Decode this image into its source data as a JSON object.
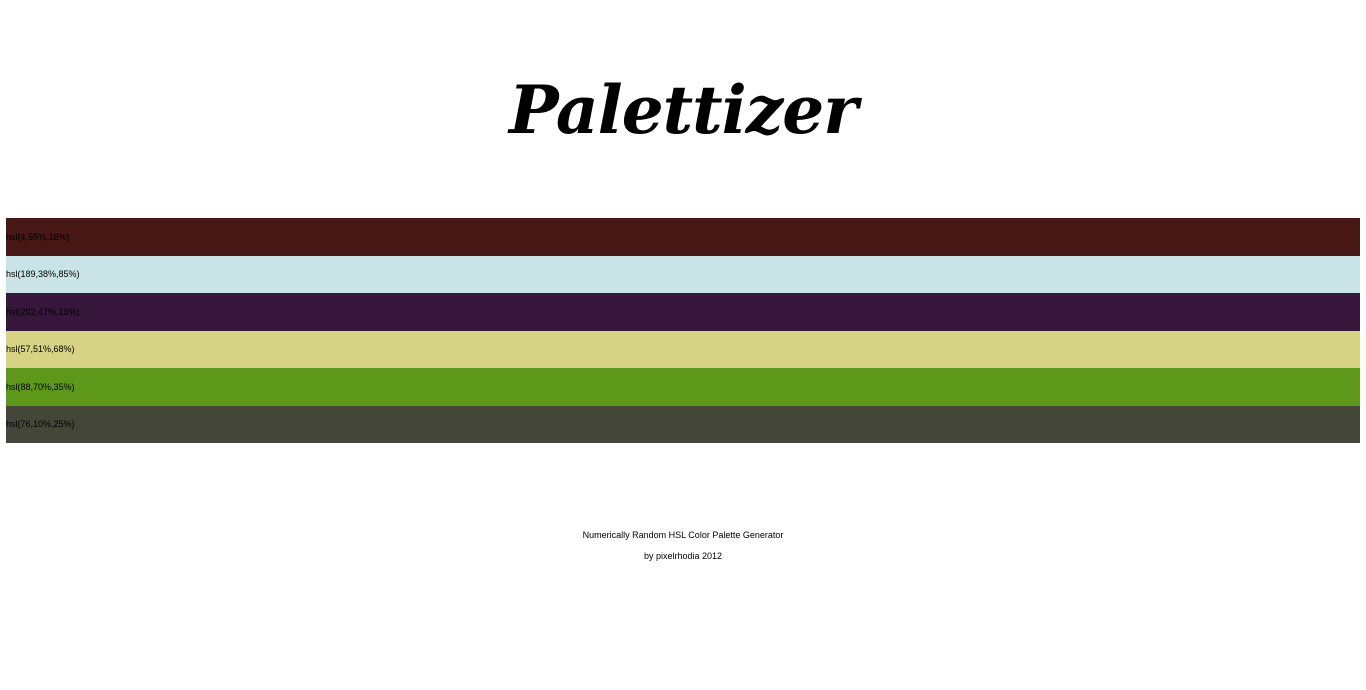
{
  "header": {
    "title": "Palettizer"
  },
  "palette": {
    "swatches": [
      {
        "label": "hsl(4,55%,18%)",
        "color": "hsl(4,55%,18%)"
      },
      {
        "label": "hsl(189,38%,85%)",
        "color": "hsl(189,38%,85%)"
      },
      {
        "label": "hsl(292,47%,16%)",
        "color": "hsl(292,47%,16%)"
      },
      {
        "label": "hsl(57,51%,68%)",
        "color": "hsl(57,51%,68%)"
      },
      {
        "label": "hsl(88,70%,35%)",
        "color": "hsl(88,70%,35%)"
      },
      {
        "label": "hsl(76,10%,25%)",
        "color": "hsl(76,10%,25%)"
      }
    ]
  },
  "footer": {
    "description": "Numerically Random HSL Color Palette Generator",
    "credit": "by pixelrhodia 2012"
  }
}
